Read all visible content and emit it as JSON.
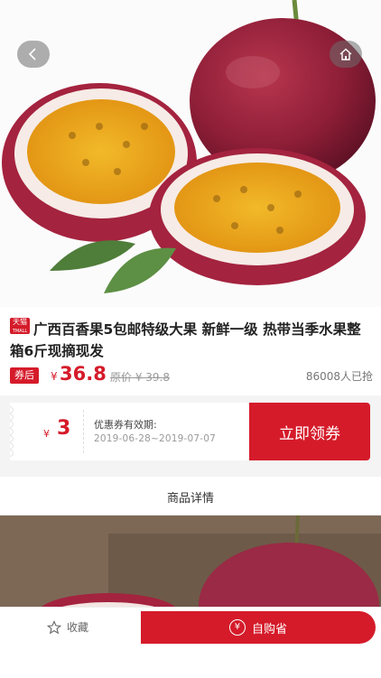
{
  "nav": {
    "back_icon": "chevron-left-icon",
    "home_icon": "home-icon"
  },
  "product": {
    "platform_badge_top": "天猫",
    "platform_badge_bottom": "TMALL",
    "title": "广西百香果5包邮特级大果 新鲜一级 热带当季水果整箱6斤现摘现发",
    "coupon_tag": "券后",
    "price_symbol": "¥",
    "price": "36.8",
    "original_price": "原价 ¥ 39.8",
    "sold_count": "86008人已抢"
  },
  "coupon": {
    "symbol": "¥",
    "value": "3",
    "validity_label": "优惠券有效期:",
    "validity_dates": "2019-06-28~2019-07-07",
    "claim_label": "立即领券"
  },
  "detail": {
    "header": "商品详情"
  },
  "bottom_bar": {
    "favorite_label": "收藏",
    "buy_label": "自购省",
    "buy_icon_text": "¥"
  },
  "colors": {
    "accent": "#d51b2a",
    "bg_gray": "#f4f4f4"
  }
}
